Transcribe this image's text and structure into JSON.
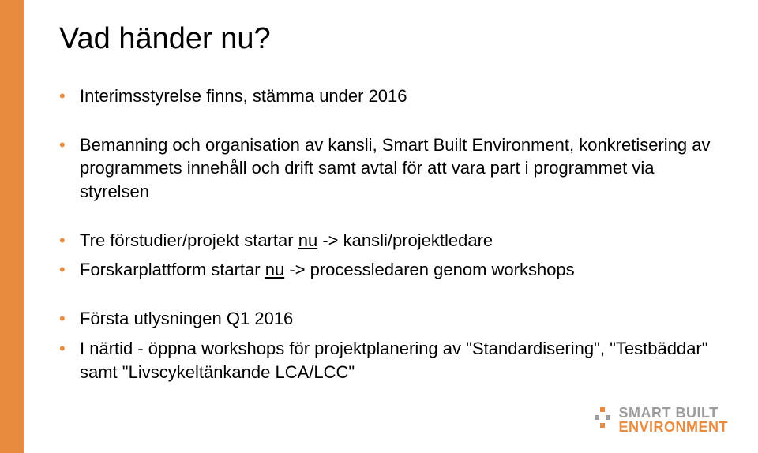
{
  "title": "Vad händer nu?",
  "bullets": {
    "b1": "Interimsstyrelse finns, stämma under 2016",
    "b2": "Bemanning och organisation av kansli, Smart Built Environment, konkretisering av programmets innehåll och drift samt avtal för att vara part i programmet via styrelsen",
    "b3_pre": "Tre förstudier/projekt startar ",
    "b3_u": "nu",
    "b3_post": " -> kansli/projektledare",
    "b4_pre": "Forskarplattform startar ",
    "b4_u": "nu",
    "b4_post": " -> processledaren genom workshops",
    "b5": "Första utlysningen Q1 2016",
    "b6": "I närtid - öppna workshops för projektplanering av \"Standardisering\", \"Testbäddar\" samt \"Livscykeltänkande LCA/LCC\""
  },
  "logo": {
    "line1": "SMART BUILT",
    "line2": "ENVIRONMENT"
  }
}
